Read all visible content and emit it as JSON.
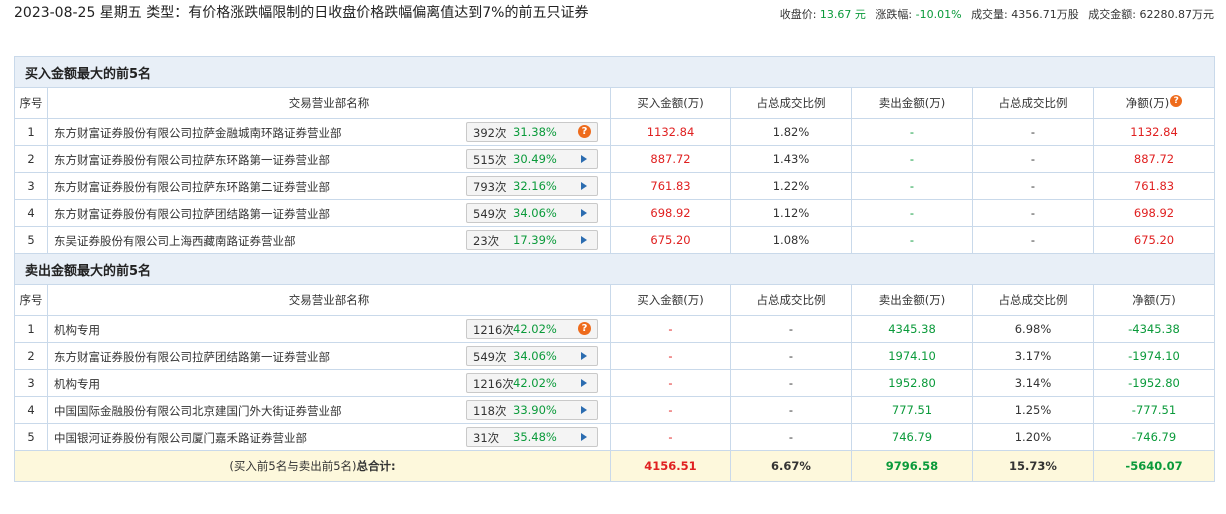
{
  "header": {
    "title": "2023-08-25 星期五 类型：有价格涨跌幅限制的日收盘价格跌幅偏离值达到7%的前五只证券",
    "close_label": "收盘价:",
    "close_value": "13.67 元",
    "change_label": "涨跌幅:",
    "change_value": "-10.01%",
    "volume_label": "成交量:",
    "volume_value": "4356.71万股",
    "amount_label": "成交金额:",
    "amount_value": "62280.87万元"
  },
  "buy_section": {
    "title": "买入金额最大的前5名",
    "columns": [
      "序号",
      "交易营业部名称",
      "买入金额(万)",
      "占总成交比例",
      "卖出金额(万)",
      "占总成交比例",
      "净额(万)"
    ],
    "rows": [
      {
        "idx": "1",
        "name": "东方财富证券股份有限公司拉萨金融城南环路证券营业部",
        "count": "392次",
        "pct": "31.38%",
        "icon": "question",
        "buy": "1132.84",
        "buy_ratio": "1.82%",
        "sell": "-",
        "sell_ratio": "-",
        "net": "1132.84"
      },
      {
        "idx": "2",
        "name": "东方财富证券股份有限公司拉萨东环路第一证券营业部",
        "count": "515次",
        "pct": "30.49%",
        "icon": "arrow",
        "buy": "887.72",
        "buy_ratio": "1.43%",
        "sell": "-",
        "sell_ratio": "-",
        "net": "887.72"
      },
      {
        "idx": "3",
        "name": "东方财富证券股份有限公司拉萨东环路第二证券营业部",
        "count": "793次",
        "pct": "32.16%",
        "icon": "arrow",
        "buy": "761.83",
        "buy_ratio": "1.22%",
        "sell": "-",
        "sell_ratio": "-",
        "net": "761.83"
      },
      {
        "idx": "4",
        "name": "东方财富证券股份有限公司拉萨团结路第一证券营业部",
        "count": "549次",
        "pct": "34.06%",
        "icon": "arrow",
        "buy": "698.92",
        "buy_ratio": "1.12%",
        "sell": "-",
        "sell_ratio": "-",
        "net": "698.92"
      },
      {
        "idx": "5",
        "name": "东吴证券股份有限公司上海西藏南路证券营业部",
        "count": "23次",
        "pct": "17.39%",
        "icon": "arrow",
        "buy": "675.20",
        "buy_ratio": "1.08%",
        "sell": "-",
        "sell_ratio": "-",
        "net": "675.20"
      }
    ]
  },
  "sell_section": {
    "title": "卖出金额最大的前5名",
    "columns": [
      "序号",
      "交易营业部名称",
      "买入金额(万)",
      "占总成交比例",
      "卖出金额(万)",
      "占总成交比例",
      "净额(万)"
    ],
    "rows": [
      {
        "idx": "1",
        "name": "机构专用",
        "count": "1216次",
        "pct": "42.02%",
        "icon": "question",
        "buy": "-",
        "buy_ratio": "-",
        "sell": "4345.38",
        "sell_ratio": "6.98%",
        "net": "-4345.38"
      },
      {
        "idx": "2",
        "name": "东方财富证券股份有限公司拉萨团结路第一证券营业部",
        "count": "549次",
        "pct": "34.06%",
        "icon": "arrow",
        "buy": "-",
        "buy_ratio": "-",
        "sell": "1974.10",
        "sell_ratio": "3.17%",
        "net": "-1974.10"
      },
      {
        "idx": "3",
        "name": "机构专用",
        "count": "1216次",
        "pct": "42.02%",
        "icon": "arrow",
        "buy": "-",
        "buy_ratio": "-",
        "sell": "1952.80",
        "sell_ratio": "3.14%",
        "net": "-1952.80"
      },
      {
        "idx": "4",
        "name": "中国国际金融股份有限公司北京建国门外大街证券营业部",
        "count": "118次",
        "pct": "33.90%",
        "icon": "arrow",
        "buy": "-",
        "buy_ratio": "-",
        "sell": "777.51",
        "sell_ratio": "1.25%",
        "net": "-777.51"
      },
      {
        "idx": "5",
        "name": "中国银河证券股份有限公司厦门嘉禾路证券营业部",
        "count": "31次",
        "pct": "35.48%",
        "icon": "arrow",
        "buy": "-",
        "buy_ratio": "-",
        "sell": "746.79",
        "sell_ratio": "1.20%",
        "net": "-746.79"
      }
    ]
  },
  "total": {
    "label_prefix": "(买入前5名与卖出前5名)",
    "label_bold": "总合计:",
    "buy": "4156.51",
    "buy_ratio": "6.67%",
    "sell": "9796.58",
    "sell_ratio": "15.73%",
    "net": "-5640.07"
  },
  "colors": {
    "positive": "#e02020",
    "negative": "#0a9a3a",
    "section_bg": "#e8eff7",
    "total_bg": "#fdf8dc"
  }
}
